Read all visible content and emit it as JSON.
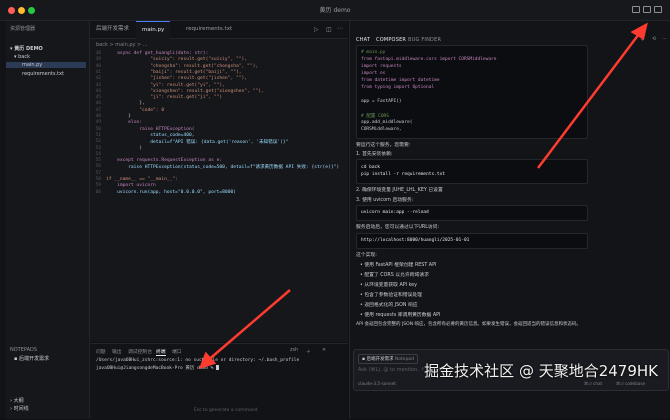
{
  "window": {
    "title": "黄历 demo"
  },
  "colors": {
    "accent": "#4d7cfe",
    "arrow": "#ff3b30",
    "selection": "#2b3a55"
  },
  "sidebar": {
    "explorer_title": "资源管理器",
    "root": "黄历 DEMO",
    "folder": "back",
    "files": [
      "main.py",
      "requirements.txt"
    ],
    "notepads_title": "NOTEPADS",
    "notepad_item": "后端开发需求",
    "bottom_items": [
      "大纲",
      "时间线"
    ]
  },
  "editor": {
    "tabs": [
      "后端开发需求",
      "main.py",
      "requirements.txt"
    ],
    "breadcrumb": "back > main.py > ...",
    "line_numbers": [
      "38",
      "39",
      "40",
      "41",
      "42",
      "43",
      "44",
      "45",
      "46",
      "47",
      "48",
      "49",
      "50",
      "51",
      "52",
      "53",
      "54",
      "55",
      "56",
      "57",
      "58",
      "59",
      "60",
      "61",
      "62",
      "63",
      "64",
      "65",
      "66"
    ],
    "code": [
      "    async def get_huangli(date: str):",
      "                \"suiciy\": result.get(\"suiciy\", \"\"),",
      "                \"chongsha\": result.get(\"chongsha\", \"\"),",
      "                \"baiji\": result.get(\"baiji\", \"\"),",
      "                \"jishen\": result.get(\"jishen\", \"\"),",
      "                \"yi\": result.get(\"yi\", \"\"),",
      "                \"xiongshen\": result.get(\"xiongshen\", \"\"),",
      "                \"ji\": result.get(\"ji\", \"\")",
      "            },",
      "            \"code\": 0",
      "        }",
      "        else:",
      "            raise HTTPException(",
      "                status_code=400,",
      "                detail=f\"API 错误: {data.get('reason', '未知错误')}\"",
      "            )",
      "",
      "    except requests.RequestException as e:",
      "        raise HTTPException(status_code=500, detail=f\"请求黄历数据 API 失败: {str(e)}\")",
      "",
      "if __name__ == \"__main__\":",
      "    import uvicorn",
      "    uvicorn.run(app, host=\"0.0.0.0\", port=8000)"
    ]
  },
  "terminal": {
    "tabs": [
      "问题",
      "输出",
      "调试控制台",
      "终端",
      "端口"
    ],
    "shell_label": "zsh",
    "lines": [
      "/Users/javaOBHui_zshrc:source:1: no such file or directory: ~/.bash_profile",
      "javaOBHui@JiangsongdeMacBook-Pro 黄历 demo % "
    ],
    "hint": "Esc to generate a command"
  },
  "chat": {
    "tabs": [
      "CHAT",
      "COMPOSER",
      "BUG FINDER"
    ],
    "code_head": [
      "# main.py",
      "from fastapi.middleware.cors import CORSMiddleware",
      "import requests",
      "import os",
      "from datetime import datetime",
      "from typing import Optional",
      "",
      "app = FastAPI()",
      "",
      "# 配置 CORS",
      "app.add_middleware(",
      "    CORSMiddleware,"
    ],
    "msg1": "要运行这个服务，您需要:",
    "step1": "1. 首先安装依赖:",
    "cmd1": [
      "cd back",
      "pip install -r requirements.txt"
    ],
    "step2": "2. 确保环境变量 JUHE_LHL_KEY 已设置",
    "step3": "3. 使用 uvicorn 启动服务:",
    "cmd2": "uvicorn main:app --reload",
    "msg2": "服务启动后，您可以通过以下URL访问:",
    "url": "http://localhost:8000/huangli/2025-01-01",
    "msg3": "这个实现:",
    "bullets": [
      "使用 FastAPI 框架创建 REST API",
      "配置了 CORS 以允许跨域请求",
      "从环境变量获取 API key",
      "包含了参数验证和错误处理",
      "返回格式化的 JSON 响应",
      "使用 requests 库调用黄历数据 API"
    ],
    "msg4": "API 会返回包含完整的 JSON 响应，包含所有必要的黄历信息。如果发生错误，会返回适当的错误信息和状态码。",
    "input_chip": "后端开发需求",
    "input_chip_tag": "Notepad",
    "input_placeholder": "Ask (⌘L), @ to mention, ↑ to select",
    "model": "claude-3.5-sonnet",
    "submit": "⌘⏎ chat",
    "codebase": "⌘⏎ codebase"
  },
  "watermark": "掘金技术社区 @ 天聚地合2479HK"
}
